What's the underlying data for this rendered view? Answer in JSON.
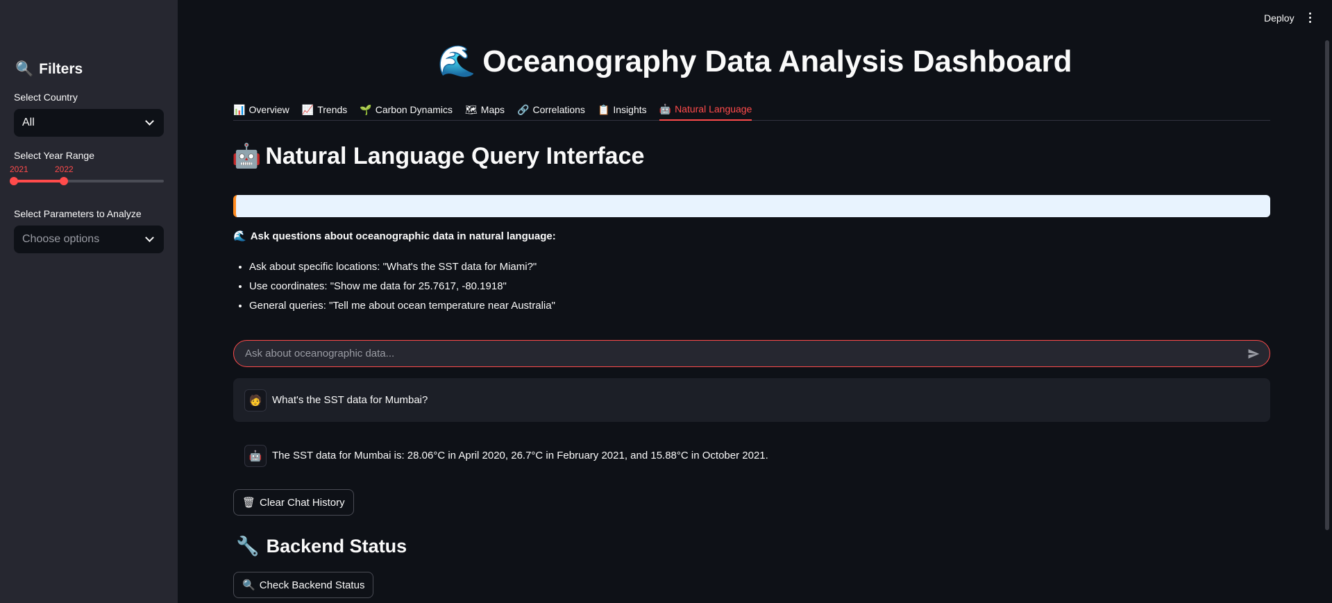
{
  "header": {
    "deploy_label": "Deploy"
  },
  "sidebar": {
    "title": "Filters",
    "country_label": "Select Country",
    "country_value": "All",
    "year_label": "Select Year Range",
    "year_min": "2021",
    "year_max": "2022",
    "params_label": "Select Parameters to Analyze",
    "params_placeholder": "Choose options"
  },
  "main": {
    "title": "Oceanography Data Analysis Dashboard",
    "tabs": [
      {
        "icon": "📊",
        "label": "Overview"
      },
      {
        "icon": "📈",
        "label": "Trends"
      },
      {
        "icon": "🌱",
        "label": "Carbon Dynamics"
      },
      {
        "icon": "🗺",
        "label": "Maps"
      },
      {
        "icon": "🔗",
        "label": "Correlations"
      },
      {
        "icon": "📋",
        "label": "Insights"
      },
      {
        "icon": "🤖",
        "label": "Natural Language"
      }
    ],
    "section_title": "Natural Language Query Interface",
    "ask_title": "Ask questions about oceanographic data in natural language:",
    "bullets": [
      "Ask about specific locations: \"What's the SST data for Miami?\"",
      "Use coordinates: \"Show me data for 25.7617, -80.1918\"",
      "General queries: \"Tell me about ocean temperature near Australia\""
    ],
    "chat_placeholder": "Ask about oceanographic data...",
    "messages": {
      "user_text": "What's the SST data for Mumbai?",
      "bot_text": "The SST data for Mumbai is: 28.06°C in April 2020, 26.7°C in February 2021, and 15.88°C in October 2021."
    },
    "clear_button": "Clear Chat History",
    "backend_title": "Backend Status",
    "check_button": "Check Backend Status"
  },
  "colors": {
    "accent": "#ff4b4b",
    "sidebar_bg": "#262730",
    "main_bg": "#0e1117"
  }
}
